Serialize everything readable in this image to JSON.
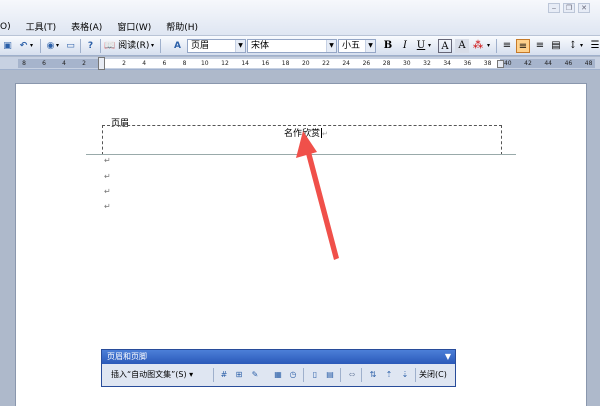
{
  "menu": {
    "items": [
      "O)",
      "工具(T)",
      "表格(A)",
      "窗口(W)",
      "帮助(H)"
    ]
  },
  "toolbar": {
    "read_label": "阅读(R)",
    "style_value": "页眉",
    "font_value": "宋体",
    "size_value": "小五",
    "bold": "B",
    "italic": "I",
    "underline": "U",
    "font_color": "A"
  },
  "ruler": {
    "ticks_left": [
      "8",
      "6",
      "4",
      "2"
    ],
    "ticks": [
      "2",
      "4",
      "6",
      "8",
      "10",
      "12",
      "14",
      "16",
      "18",
      "20",
      "22",
      "24",
      "26",
      "28",
      "30",
      "32",
      "34",
      "36",
      "38",
      "40",
      "42",
      "44",
      "46",
      "48"
    ]
  },
  "document": {
    "header_label": "页眉",
    "header_text": "名作欣赏",
    "paragraph_mark": "↵"
  },
  "header_footer_toolbar": {
    "title": "页眉和页脚",
    "insert_autotext": "插入“自动图文集”(S)",
    "close_label": "关闭(C)"
  },
  "colors": {
    "annotation_arrow": "#f0504a",
    "active_button": "#ffd28c",
    "title_bar": "#2a59b9"
  }
}
